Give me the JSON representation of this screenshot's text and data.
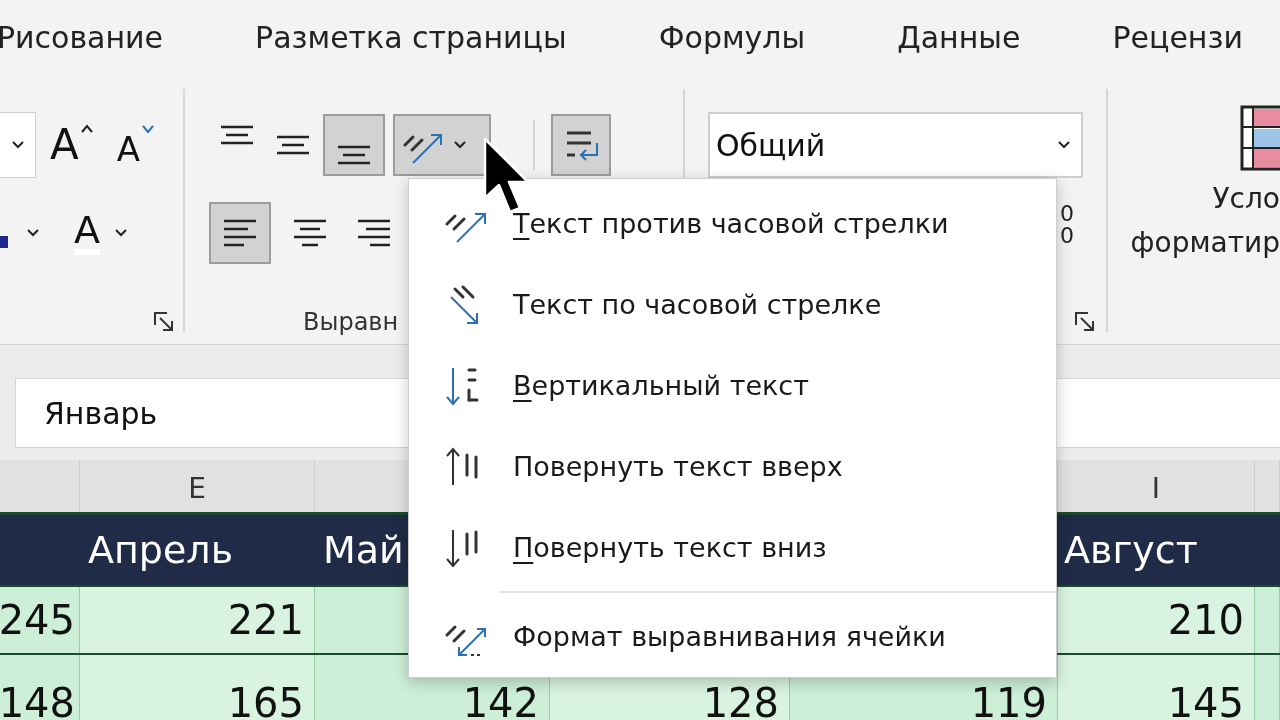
{
  "ribbon_tabs": [
    {
      "label": "Рисование"
    },
    {
      "label": "Разметка страницы"
    },
    {
      "label": "Формулы"
    },
    {
      "label": "Данные"
    },
    {
      "label": "Рецензи"
    }
  ],
  "font_group": {
    "grow_font_glyph": "A",
    "shrink_font_glyph": "A",
    "font_color_glyph": "A"
  },
  "alignment_group": {
    "label": "Выравн",
    "vertical": [
      {
        "kind": "top",
        "selected": false
      },
      {
        "kind": "middle",
        "selected": false
      },
      {
        "kind": "bottom",
        "selected": true
      }
    ],
    "orientation": {
      "selected": true
    },
    "wrap_text": {
      "selected": true
    },
    "horizontal": [
      {
        "kind": "left",
        "selected": true
      },
      {
        "kind": "center",
        "selected": false
      },
      {
        "kind": "right",
        "selected": false
      }
    ]
  },
  "number_group": {
    "format": "Общий",
    "decimal_digits": [
      "0",
      "0"
    ]
  },
  "conditional_formatting": {
    "label_lines": [
      "Усло",
      "форматир"
    ]
  },
  "formula_bar": {
    "value": "Январь"
  },
  "sheet": {
    "columns": [
      {
        "cells": [
          "245",
          "148"
        ]
      },
      {
        "letter": "E",
        "heading": "Апрель",
        "cells": [
          "221",
          "165"
        ]
      },
      {
        "heading": "Май",
        "cells": [
          null,
          "142"
        ]
      },
      {
        "cells": [
          null,
          "128"
        ]
      },
      {
        "cells": [
          null,
          "119"
        ]
      },
      {
        "letter": "I",
        "heading": "Август",
        "cells": [
          "210",
          "145"
        ]
      }
    ]
  },
  "orientation_menu": {
    "items": [
      {
        "kind": "counterclockwise",
        "label": "Текст против часовой стрелки",
        "access_key_underlined": true,
        "separator_before": false
      },
      {
        "kind": "clockwise",
        "label": "Текст по часовой стрелке",
        "access_key_underlined": false,
        "separator_before": false
      },
      {
        "kind": "vertical",
        "label": "Вертикальный текст",
        "access_key_underlined": true,
        "separator_before": false
      },
      {
        "kind": "rotate_up",
        "label": "Повернуть текст вверх",
        "access_key_underlined": false,
        "separator_before": false
      },
      {
        "kind": "rotate_down",
        "label": "Повернуть текст вниз",
        "access_key_underlined": true,
        "separator_before": false
      },
      {
        "kind": "format",
        "label": "Формат выравнивания ячейки",
        "access_key_underlined": false,
        "separator_before": true
      }
    ]
  }
}
